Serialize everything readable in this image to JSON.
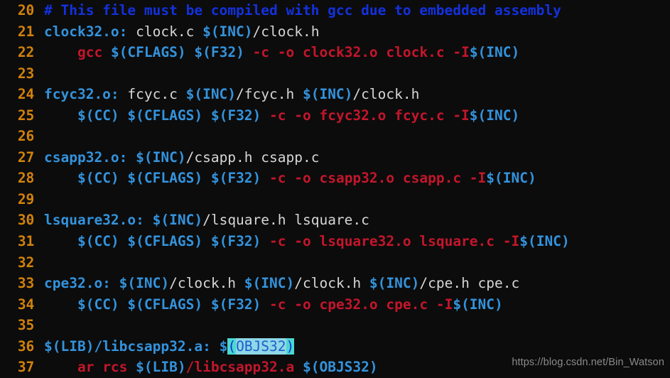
{
  "editor": {
    "background_color": "#0c0c0c",
    "gutter_color": "#d2820a",
    "first_line_number": 20,
    "last_line_number": 37,
    "language": "makefile",
    "filename_hint": "Makefile"
  },
  "colors": {
    "comment": "#1331dd",
    "target": "#3393dd",
    "variable": "#3393dd",
    "prerequisite": "#d6d6d6",
    "command": "#c4162b",
    "selection_bracket": "#4ad8cf",
    "selection_inner": "#8fd8e8"
  },
  "selection": {
    "text": "(OBJS32)",
    "line_number": 36,
    "bracket_open": "(",
    "bracket_close": ")",
    "inner_text": "OBJS32"
  },
  "watermark": {
    "text": "https://blog.csdn.net/Bin_Watson"
  },
  "lines": [
    {
      "number": "20",
      "tokens": [
        {
          "text": "# This file must be compiled with gcc due to embedded assembly",
          "cls": "tok-comment"
        }
      ]
    },
    {
      "number": "21",
      "tokens": [
        {
          "text": "clock32.o:",
          "cls": "tok-target"
        },
        {
          "text": " clock.c ",
          "cls": "tok-prereq"
        },
        {
          "text": "$(INC)",
          "cls": "tok-var"
        },
        {
          "text": "/clock.h",
          "cls": "tok-prereq"
        }
      ]
    },
    {
      "number": "22",
      "tokens": [
        {
          "text": "    ",
          "cls": "tok-plain"
        },
        {
          "text": "gcc",
          "cls": "tok-cmd"
        },
        {
          "text": " ",
          "cls": "tok-plain"
        },
        {
          "text": "$(CFLAGS)",
          "cls": "tok-var"
        },
        {
          "text": " ",
          "cls": "tok-plain"
        },
        {
          "text": "$(F32)",
          "cls": "tok-var"
        },
        {
          "text": " -c -o clock32.o clock.c -I",
          "cls": "tok-arg"
        },
        {
          "text": "$(INC)",
          "cls": "tok-var"
        }
      ]
    },
    {
      "number": "23",
      "tokens": []
    },
    {
      "number": "24",
      "tokens": [
        {
          "text": "fcyc32.o:",
          "cls": "tok-target"
        },
        {
          "text": " fcyc.c ",
          "cls": "tok-prereq"
        },
        {
          "text": "$(INC)",
          "cls": "tok-var"
        },
        {
          "text": "/fcyc.h ",
          "cls": "tok-prereq"
        },
        {
          "text": "$(INC)",
          "cls": "tok-var"
        },
        {
          "text": "/clock.h",
          "cls": "tok-prereq"
        }
      ]
    },
    {
      "number": "25",
      "tokens": [
        {
          "text": "    ",
          "cls": "tok-plain"
        },
        {
          "text": "$(CC)",
          "cls": "tok-var"
        },
        {
          "text": " ",
          "cls": "tok-plain"
        },
        {
          "text": "$(CFLAGS)",
          "cls": "tok-var"
        },
        {
          "text": " ",
          "cls": "tok-plain"
        },
        {
          "text": "$(F32)",
          "cls": "tok-var"
        },
        {
          "text": " -c -o fcyc32.o fcyc.c -I",
          "cls": "tok-arg"
        },
        {
          "text": "$(INC)",
          "cls": "tok-var"
        }
      ]
    },
    {
      "number": "26",
      "tokens": []
    },
    {
      "number": "27",
      "tokens": [
        {
          "text": "csapp32.o:",
          "cls": "tok-target"
        },
        {
          "text": " ",
          "cls": "tok-plain"
        },
        {
          "text": "$(INC)",
          "cls": "tok-var"
        },
        {
          "text": "/csapp.h csapp.c",
          "cls": "tok-prereq"
        }
      ]
    },
    {
      "number": "28",
      "tokens": [
        {
          "text": "    ",
          "cls": "tok-plain"
        },
        {
          "text": "$(CC)",
          "cls": "tok-var"
        },
        {
          "text": " ",
          "cls": "tok-plain"
        },
        {
          "text": "$(CFLAGS)",
          "cls": "tok-var"
        },
        {
          "text": " ",
          "cls": "tok-plain"
        },
        {
          "text": "$(F32)",
          "cls": "tok-var"
        },
        {
          "text": " -c -o csapp32.o csapp.c -I",
          "cls": "tok-arg"
        },
        {
          "text": "$(INC)",
          "cls": "tok-var"
        }
      ]
    },
    {
      "number": "29",
      "tokens": []
    },
    {
      "number": "30",
      "tokens": [
        {
          "text": "lsquare32.o:",
          "cls": "tok-target"
        },
        {
          "text": " ",
          "cls": "tok-plain"
        },
        {
          "text": "$(INC)",
          "cls": "tok-var"
        },
        {
          "text": "/lsquare.h lsquare.c",
          "cls": "tok-prereq"
        }
      ]
    },
    {
      "number": "31",
      "tokens": [
        {
          "text": "    ",
          "cls": "tok-plain"
        },
        {
          "text": "$(CC)",
          "cls": "tok-var"
        },
        {
          "text": " ",
          "cls": "tok-plain"
        },
        {
          "text": "$(CFLAGS)",
          "cls": "tok-var"
        },
        {
          "text": " ",
          "cls": "tok-plain"
        },
        {
          "text": "$(F32)",
          "cls": "tok-var"
        },
        {
          "text": " -c -o lsquare32.o lsquare.c -I",
          "cls": "tok-arg"
        },
        {
          "text": "$(INC)",
          "cls": "tok-var"
        }
      ]
    },
    {
      "number": "32",
      "tokens": []
    },
    {
      "number": "33",
      "tokens": [
        {
          "text": "cpe32.o:",
          "cls": "tok-target"
        },
        {
          "text": " ",
          "cls": "tok-plain"
        },
        {
          "text": "$(INC)",
          "cls": "tok-var"
        },
        {
          "text": "/clock.h ",
          "cls": "tok-prereq"
        },
        {
          "text": "$(INC)",
          "cls": "tok-var"
        },
        {
          "text": "/clock.h ",
          "cls": "tok-prereq"
        },
        {
          "text": "$(INC)",
          "cls": "tok-var"
        },
        {
          "text": "/cpe.h cpe.c",
          "cls": "tok-prereq"
        }
      ]
    },
    {
      "number": "34",
      "tokens": [
        {
          "text": "    ",
          "cls": "tok-plain"
        },
        {
          "text": "$(CC)",
          "cls": "tok-var"
        },
        {
          "text": " ",
          "cls": "tok-plain"
        },
        {
          "text": "$(CFLAGS)",
          "cls": "tok-var"
        },
        {
          "text": " ",
          "cls": "tok-plain"
        },
        {
          "text": "$(F32)",
          "cls": "tok-var"
        },
        {
          "text": " -c -o cpe32.o cpe.c -I",
          "cls": "tok-arg"
        },
        {
          "text": "$(INC)",
          "cls": "tok-var"
        }
      ]
    },
    {
      "number": "35",
      "tokens": []
    },
    {
      "number": "36",
      "tokens": [
        {
          "text": "$(LIB)",
          "cls": "tok-var"
        },
        {
          "text": "/libcsapp32.a:",
          "cls": "tok-target"
        },
        {
          "text": " ",
          "cls": "tok-plain"
        },
        {
          "text": "$",
          "cls": "tok-var"
        },
        {
          "text": "(",
          "cls": "sel-bracket"
        },
        {
          "text": "OBJS32",
          "cls": "sel-inner"
        },
        {
          "text": ")",
          "cls": "sel-bracket"
        }
      ]
    },
    {
      "number": "37",
      "tokens": [
        {
          "text": "    ",
          "cls": "tok-plain"
        },
        {
          "text": "ar rcs ",
          "cls": "tok-cmd"
        },
        {
          "text": "$(LIB)",
          "cls": "tok-var"
        },
        {
          "text": "/libcsapp32.a",
          "cls": "tok-cmd"
        },
        {
          "text": " ",
          "cls": "tok-plain"
        },
        {
          "text": "$(OBJS32)",
          "cls": "tok-var"
        }
      ]
    }
  ]
}
